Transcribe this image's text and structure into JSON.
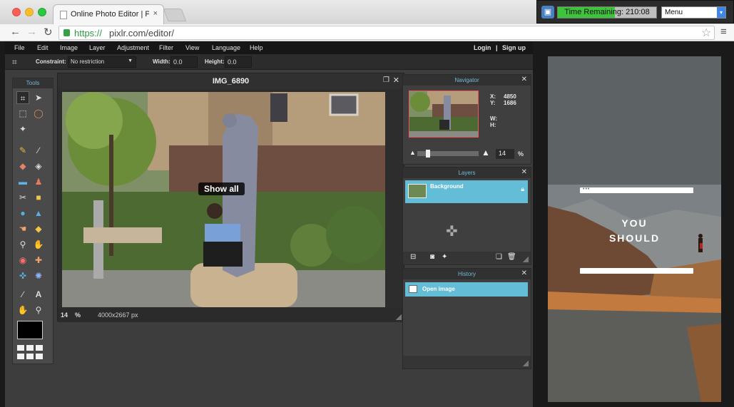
{
  "browser": {
    "tab_title": "Online Photo Editor | Pixlr",
    "tab_close": "×",
    "url_scheme": "https://",
    "url_rest": "pixlr.com/editor/"
  },
  "timer": {
    "label": "Time Remaining: 210:08",
    "progress": 0.58,
    "menu_label": "Menu"
  },
  "menubar": {
    "items": [
      "File",
      "Edit",
      "Image",
      "Layer",
      "Adjustment",
      "Filter",
      "View",
      "Language",
      "Help"
    ],
    "login": "Login",
    "separator": "|",
    "signup": "Sign up"
  },
  "options": {
    "constraint_label": "Constraint:",
    "constraint_value": "No restriction",
    "width_label": "Width:",
    "width_value": "0.0",
    "height_label": "Height:",
    "height_value": "0.0"
  },
  "tools": {
    "header": "Tools"
  },
  "image_window": {
    "title": "IMG_6890",
    "show_all": "Show all",
    "zoom": "14",
    "zoom_unit": "%",
    "size": "4000x2667 px"
  },
  "navigator": {
    "header": "Navigator",
    "x_label": "X:",
    "x_value": "4850",
    "y_label": "Y:",
    "y_value": "1686",
    "w_label": "W:",
    "h_label": "H:",
    "zoom": "14",
    "zoom_unit": "%"
  },
  "layers": {
    "header": "Layers",
    "items": [
      {
        "name": "Background"
      }
    ]
  },
  "history": {
    "header": "History",
    "items": [
      {
        "name": "Open image"
      }
    ]
  },
  "ad": {
    "dots": "•••",
    "line1": "YOU",
    "line2": "SHOULD"
  },
  "colors": {
    "accent": "#63bdd6",
    "header_text": "#73b9d8",
    "timer_fill": "#3ec43a"
  }
}
